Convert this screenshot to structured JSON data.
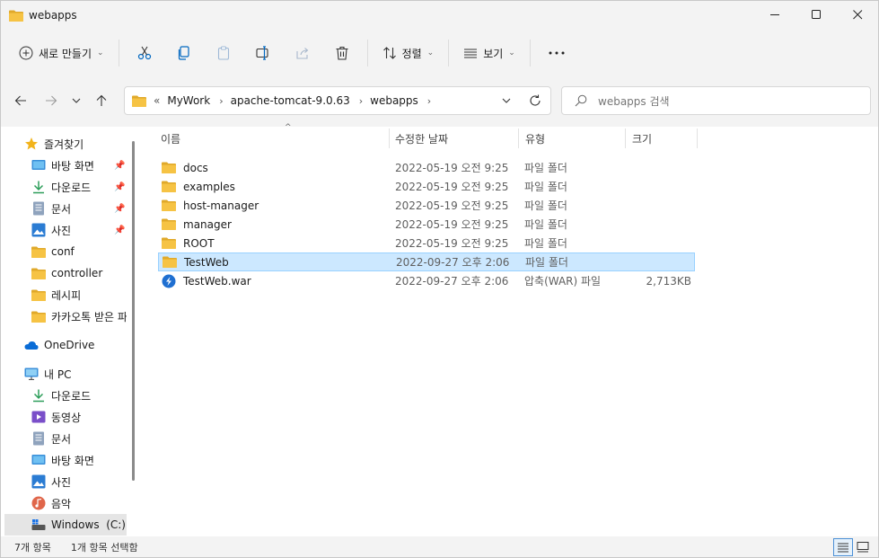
{
  "window": {
    "title": "webapps",
    "controls": [
      "minimize",
      "maximize",
      "close"
    ]
  },
  "toolbar": {
    "new_label": "새로 만들기",
    "sort_label": "정렬",
    "view_label": "보기"
  },
  "address": {
    "overflow": "«",
    "crumbs": [
      "MyWork",
      "apache-tomcat-9.0.63",
      "webapps"
    ]
  },
  "search": {
    "placeholder": "webapps 검색"
  },
  "sidebar": {
    "quick_access": "즐겨찾기",
    "items": [
      {
        "label": "바탕 화면",
        "icon": "desktop-icon",
        "pinned": true
      },
      {
        "label": "다운로드",
        "icon": "download-icon",
        "pinned": true
      },
      {
        "label": "문서",
        "icon": "document-icon",
        "pinned": true
      },
      {
        "label": "사진",
        "icon": "picture-icon",
        "pinned": true
      },
      {
        "label": "conf",
        "icon": "folder-icon",
        "pinned": false
      },
      {
        "label": "controller",
        "icon": "folder-icon",
        "pinned": false
      },
      {
        "label": "레시피",
        "icon": "folder-icon",
        "pinned": false
      },
      {
        "label": "카카오톡 받은 파일",
        "icon": "folder-icon",
        "pinned": false
      }
    ],
    "onedrive": "OneDrive",
    "this_pc": "내 PC",
    "pc_items": [
      {
        "label": "다운로드",
        "icon": "download-icon"
      },
      {
        "label": "동영상",
        "icon": "video-icon"
      },
      {
        "label": "문서",
        "icon": "document-icon"
      },
      {
        "label": "바탕 화면",
        "icon": "desktop-icon"
      },
      {
        "label": "사진",
        "icon": "picture-icon"
      },
      {
        "label": "음악",
        "icon": "music-icon"
      },
      {
        "label": "Windows  (C:)",
        "icon": "drive-icon"
      }
    ]
  },
  "columns": {
    "name": "이름",
    "date": "수정한 날짜",
    "type": "유형",
    "size": "크기"
  },
  "files": [
    {
      "name": "docs",
      "date": "2022-05-19 오전 9:25",
      "type": "파일 폴더",
      "size": "",
      "icon": "folder-icon"
    },
    {
      "name": "examples",
      "date": "2022-05-19 오전 9:25",
      "type": "파일 폴더",
      "size": "",
      "icon": "folder-icon"
    },
    {
      "name": "host-manager",
      "date": "2022-05-19 오전 9:25",
      "type": "파일 폴더",
      "size": "",
      "icon": "folder-icon"
    },
    {
      "name": "manager",
      "date": "2022-05-19 오전 9:25",
      "type": "파일 폴더",
      "size": "",
      "icon": "folder-icon"
    },
    {
      "name": "ROOT",
      "date": "2022-05-19 오전 9:25",
      "type": "파일 폴더",
      "size": "",
      "icon": "folder-icon"
    },
    {
      "name": "TestWeb",
      "date": "2022-09-27 오후 2:06",
      "type": "파일 폴더",
      "size": "",
      "icon": "folder-icon",
      "selected": true
    },
    {
      "name": "TestWeb.war",
      "date": "2022-09-27 오후 2:06",
      "type": "압축(WAR) 파일",
      "size": "2,713KB",
      "icon": "war-file-icon"
    }
  ],
  "status": {
    "count": "7개 항목",
    "selected": "1개 항목 선택함"
  },
  "colors": {
    "folder": "#f6c344",
    "folder_dark": "#e0a92a",
    "selection": "#cce8ff",
    "selection_border": "#99d1ff",
    "accent": "#0067c0"
  }
}
